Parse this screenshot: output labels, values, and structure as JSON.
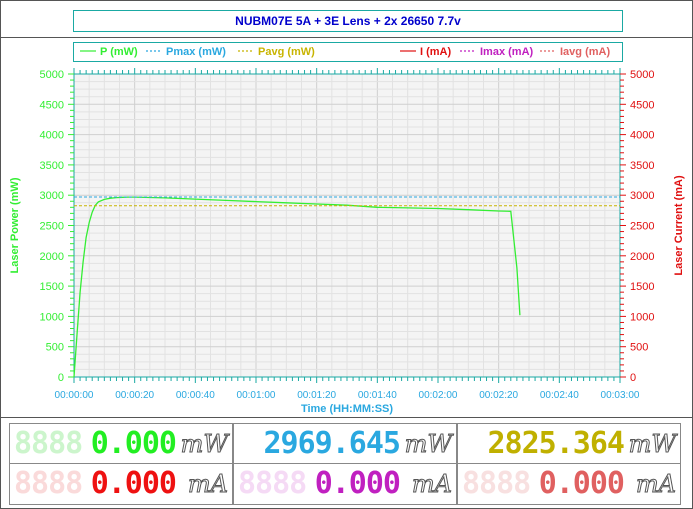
{
  "title": "NUBM07E 5A + 3E Lens + 2x 26650 7.7v",
  "colors": {
    "power": "#33ee33",
    "pmax": "#2aa8e0",
    "pavg": "#c8b400",
    "current": "#e01010",
    "imax": "#c020c0",
    "iavg": "#e06060",
    "grid": "#dddddd",
    "axis": "#1aa9a3"
  },
  "chart_data": {
    "type": "line",
    "xlabel": "Time (HH:MM:SS)",
    "ylabel_left": "Laser Power (mW)",
    "ylabel_right": "Laser Current (mA)",
    "xlim": [
      0,
      180
    ],
    "ylim_left": [
      0,
      5000
    ],
    "ylim_right": [
      0,
      5000
    ],
    "x_tick_labels": [
      "00:00:00",
      "00:00:20",
      "00:00:40",
      "00:01:00",
      "00:01:20",
      "00:01:40",
      "00:02:00",
      "00:02:20",
      "00:02:40",
      "00:03:00"
    ],
    "y_tick_labels": [
      "0",
      "500",
      "1000",
      "1500",
      "2000",
      "2500",
      "3000",
      "3500",
      "4000",
      "4500",
      "5000"
    ],
    "grid": true,
    "legend_position": "top",
    "legend": [
      "P (mW)",
      "Pmax (mW)",
      "Pavg (mW)",
      "I (mA)",
      "Imax (mA)",
      "Iavg (mA)"
    ],
    "series": [
      {
        "name": "P (mW)",
        "axis": "left",
        "x": [
          0,
          1,
          2,
          3,
          4,
          5,
          6,
          7,
          8,
          10,
          12,
          14,
          16,
          18,
          20,
          30,
          40,
          50,
          60,
          70,
          80,
          90,
          100,
          110,
          120,
          130,
          140,
          144,
          146,
          147
        ],
        "y": [
          0,
          700,
          1400,
          1900,
          2300,
          2550,
          2720,
          2830,
          2890,
          2930,
          2950,
          2960,
          2965,
          2969,
          2968,
          2955,
          2935,
          2915,
          2895,
          2875,
          2855,
          2835,
          2800,
          2790,
          2780,
          2760,
          2740,
          2735,
          1800,
          1020
        ]
      },
      {
        "name": "Pmax (mW)",
        "axis": "left",
        "type": "hline",
        "value": 2969.645
      },
      {
        "name": "Pavg (mW)",
        "axis": "left",
        "type": "hline",
        "value": 2825.364
      }
    ]
  },
  "readouts": [
    {
      "id": "p-now",
      "ghost": "8888",
      "value": "0.000",
      "unit": "mW"
    },
    {
      "id": "p-max",
      "ghost": "",
      "value": "2969.645",
      "unit": "mW"
    },
    {
      "id": "p-avg",
      "ghost": "",
      "value": "2825.364",
      "unit": "mW"
    },
    {
      "id": "i-now",
      "ghost": "8888",
      "value": "0.000",
      "unit": "mA"
    },
    {
      "id": "i-max",
      "ghost": "8888",
      "value": "0.000",
      "unit": "mA"
    },
    {
      "id": "i-avg",
      "ghost": "8888",
      "value": "0.000",
      "unit": "mA"
    }
  ]
}
